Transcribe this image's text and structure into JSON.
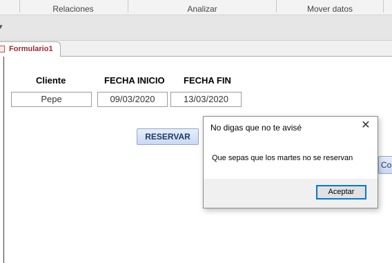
{
  "ribbon": {
    "groups": [
      "Relaciones",
      "Analizar",
      "Mover datos"
    ]
  },
  "qat": {
    "chevron_icon": "chevron-down-icon"
  },
  "tabs": {
    "active": "Formulario1",
    "icon": "form-icon"
  },
  "form": {
    "labels": {
      "cliente": "Cliente",
      "fecha_inicio": "FECHA INICIO",
      "fecha_fin": "FECHA FIN"
    },
    "values": {
      "cliente": "Pepe",
      "fecha_inicio": "09/03/2020",
      "fecha_fin": "13/03/2020"
    },
    "reservar_label": "RESERVAR",
    "partial_button_label": "Co"
  },
  "dialog": {
    "title": "No digas que no te avisé",
    "message": "Que sepas que los martes no se reservan",
    "ok_label": "Aceptar",
    "close_icon": "close-icon"
  }
}
